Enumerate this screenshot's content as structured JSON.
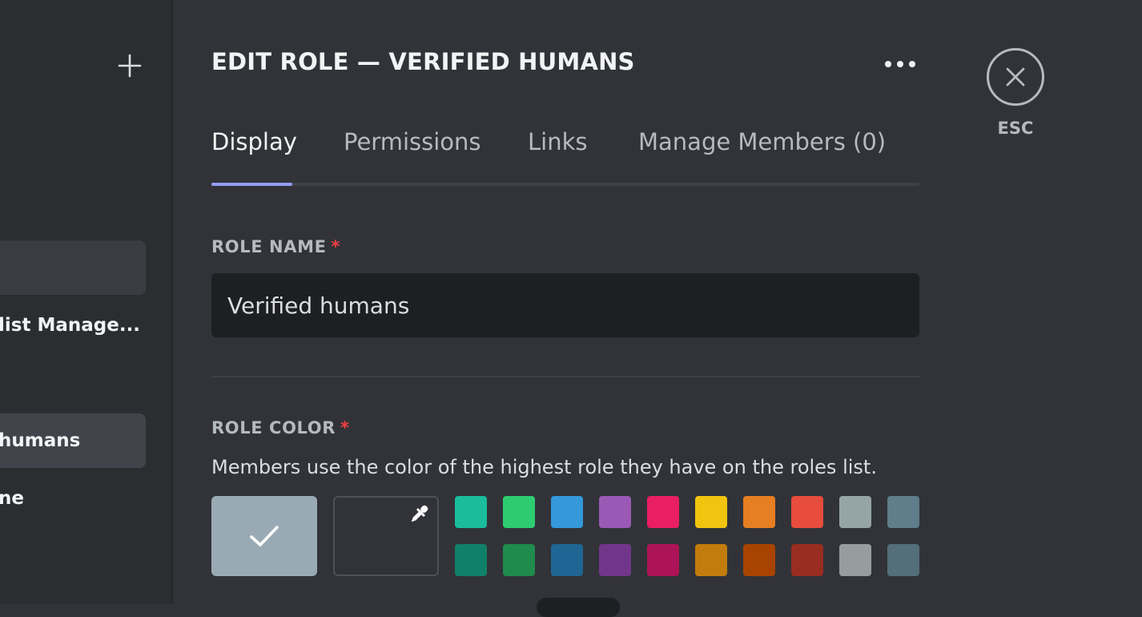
{
  "sidebar": {
    "roles": [
      {
        "label": "",
        "state": "hover"
      },
      {
        "label": "list Manage...",
        "state": "normal"
      },
      {
        "label": "humans",
        "state": "selected"
      },
      {
        "label": "ne",
        "state": "normal"
      }
    ],
    "add_icon": "plus-icon"
  },
  "header": {
    "title": "EDIT ROLE — VERIFIED HUMANS",
    "more_icon": "ellipsis-icon"
  },
  "tabs": [
    {
      "label": "Display",
      "active": true
    },
    {
      "label": "Permissions",
      "active": false
    },
    {
      "label": "Links",
      "active": false
    },
    {
      "label": "Manage Members (0)",
      "active": false
    }
  ],
  "role_name": {
    "label": "ROLE NAME",
    "required_mark": "*",
    "value": "Verified humans"
  },
  "role_color": {
    "label": "ROLE COLOR",
    "required_mark": "*",
    "hint": "Members use the color of the highest role they have on the roles list.",
    "default_color": "#99aab5",
    "default_selected": true,
    "custom_icon": "eyedropper-icon",
    "swatches_top": [
      "#1abc9c",
      "#2ecc71",
      "#3498db",
      "#9b59b6",
      "#e91e63",
      "#f1c40f",
      "#e67e22",
      "#e74c3c",
      "#95a5a6",
      "#607d8b"
    ],
    "swatches_bottom": [
      "#11806a",
      "#1f8b4c",
      "#206694",
      "#71368a",
      "#ad1457",
      "#c27c0e",
      "#a84300",
      "#992d22",
      "#979c9f",
      "#546e7a"
    ]
  },
  "close": {
    "icon": "close-icon",
    "label": "ESC"
  }
}
